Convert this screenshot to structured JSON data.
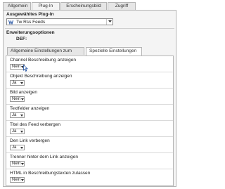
{
  "tabs": [
    {
      "label": "Allgemein",
      "active": false
    },
    {
      "label": "Plug-In",
      "active": true
    },
    {
      "label": "Erscheinungsbild",
      "active": false
    },
    {
      "label": "Zugriff",
      "active": false
    }
  ],
  "plugin": {
    "section_label": "Ausgewähltes Plug-In",
    "selected": "Tw Rss Feeds",
    "icon": "rss-plugin-icon"
  },
  "options": {
    "section_label": "Erweiterungsoptionen",
    "def_label": "DEF:"
  },
  "subtabs": [
    {
      "label": "Allgemeine Einstellungen zum Feed",
      "active": false
    },
    {
      "label": "Spezielle Einstellungen",
      "active": true
    }
  ],
  "settings": [
    {
      "label": "Channel Beschreibung anzeigen",
      "value": "Nein"
    },
    {
      "label": "Objekt Beschreibung anzeigen",
      "value": "Ja"
    },
    {
      "label": "Bild anzeigen",
      "value": "Nein"
    },
    {
      "label": "Textfelder anzeigen",
      "value": "Ja"
    },
    {
      "label": "Titel des Feed verbergen",
      "value": "Ja"
    },
    {
      "label": "Den Link verbergen",
      "value": "Ja"
    },
    {
      "label": "Trenner hinter dem Link anzeigen",
      "value": "Nein"
    },
    {
      "label": "HTML in Beschreibungstexten zulassen",
      "value": "Nein"
    }
  ],
  "colors": {
    "accent": "#1f4fa0",
    "panel": "#f4f4f4",
    "border": "#b5b5b5"
  }
}
